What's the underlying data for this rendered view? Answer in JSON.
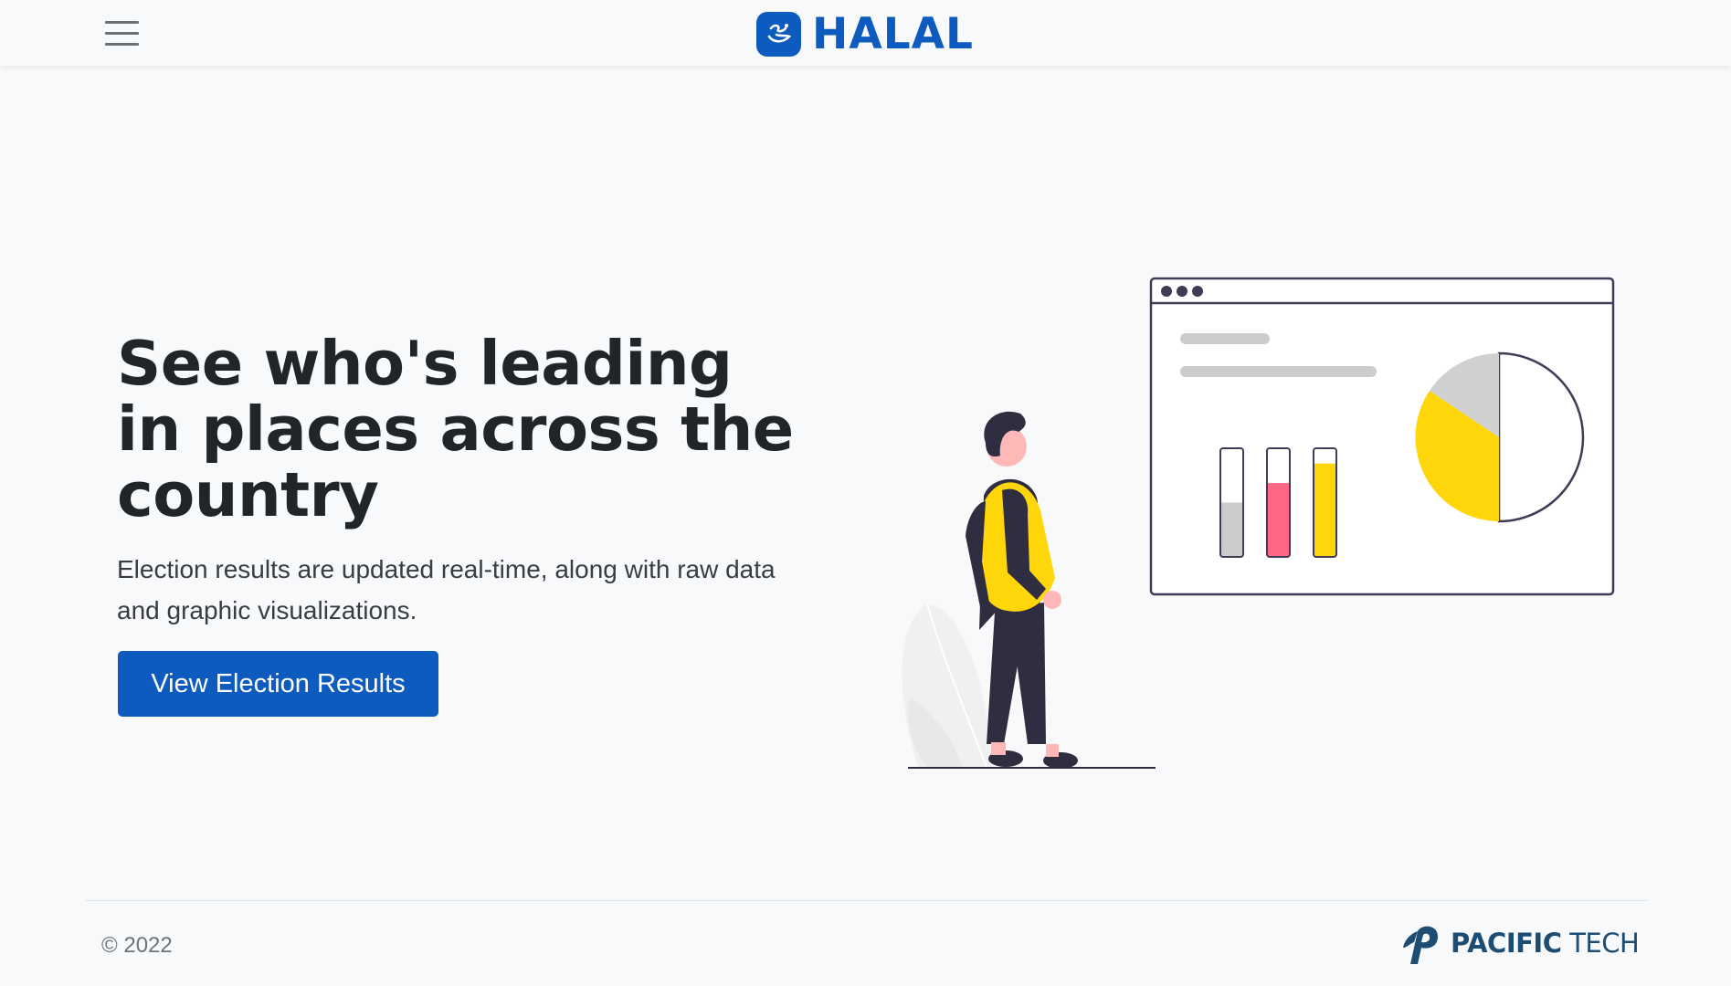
{
  "header": {
    "menu_icon": "hamburger-menu-icon",
    "brand_name": "HALAL",
    "brand_icon": "halal-logo-icon"
  },
  "hero": {
    "title": "See who's leading in places across the country",
    "subtitle": "Election results are updated real-time, along with raw data and graphic visualizations.",
    "cta_label": "View Election Results"
  },
  "illustration": {
    "description_icon": "person-viewing-dashboard-illustration",
    "bar_fills": [
      0.5,
      0.68,
      0.86
    ],
    "bar_colors": [
      "#cccccc",
      "#ff6584",
      "#ffd60a"
    ]
  },
  "footer": {
    "copyright": "© 2022",
    "company_bold": "PACIFIC",
    "company_light": " TECH",
    "company_icon": "pacific-tech-logo-icon"
  },
  "colors": {
    "primary": "#0d5bbf",
    "accent_yellow": "#ffd60a",
    "accent_pink": "#ff6584",
    "dark": "#2f2e41"
  }
}
